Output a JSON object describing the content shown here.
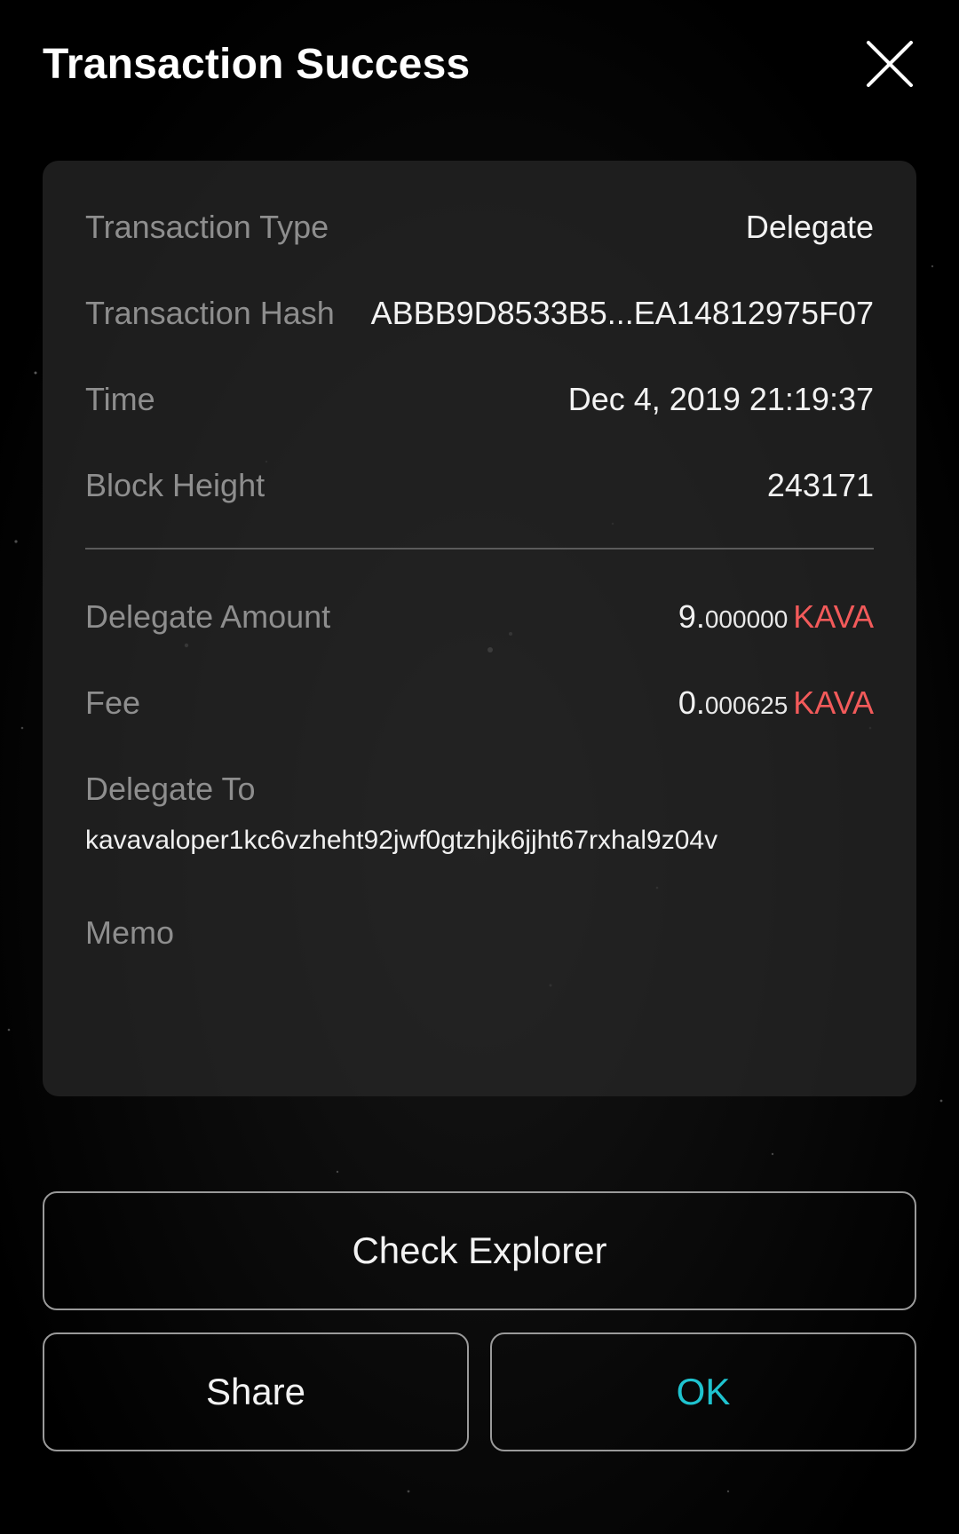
{
  "header": {
    "title": "Transaction Success",
    "close_icon": "close-icon"
  },
  "details": {
    "type_label": "Transaction Type",
    "type_value": "Delegate",
    "hash_label": "Transaction Hash",
    "hash_value": "ABBB9D8533B5...EA14812975F07",
    "time_label": "Time",
    "time_value": "Dec 4, 2019 21:19:37",
    "height_label": "Block Height",
    "height_value": "243171",
    "amount_label": "Delegate Amount",
    "amount_int": "9.",
    "amount_dec": "000000",
    "amount_denom": "KAVA",
    "fee_label": "Fee",
    "fee_int": "0.",
    "fee_dec": "000625",
    "fee_denom": "KAVA",
    "delegate_to_label": "Delegate To",
    "delegate_to_value": "kavavaloper1kc6vzheht92jwf0gtzhjk6jjht67rxhal9z04v",
    "memo_label": "Memo",
    "memo_value": ""
  },
  "buttons": {
    "check_explorer": "Check Explorer",
    "share": "Share",
    "ok": "OK"
  },
  "colors": {
    "denom": "#f25a5a",
    "ok_accent": "#1fc3cf",
    "card_bg": "#282828",
    "label": "#8e8e8e"
  }
}
